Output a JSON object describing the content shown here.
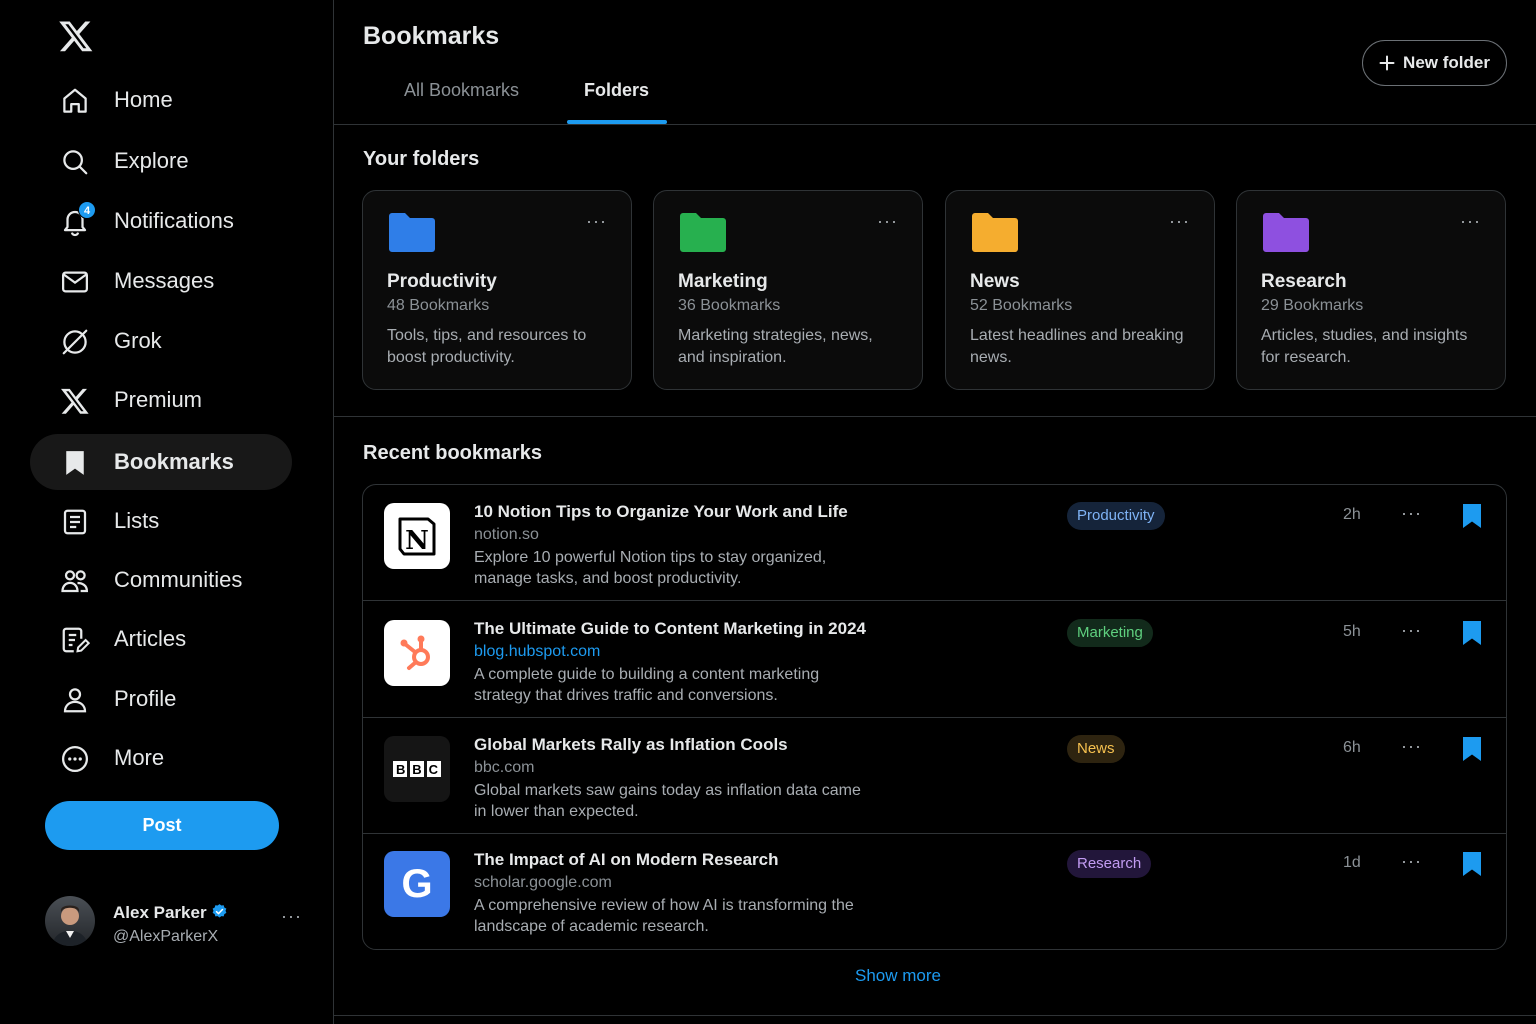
{
  "sidebar": {
    "nav": [
      {
        "label": "Home",
        "icon": "home-icon"
      },
      {
        "label": "Explore",
        "icon": "search-icon"
      },
      {
        "label": "Notifications",
        "icon": "bell-icon",
        "badge": "4"
      },
      {
        "label": "Messages",
        "icon": "mail-icon"
      },
      {
        "label": "Grok",
        "icon": "grok-icon"
      },
      {
        "label": "Premium",
        "icon": "x-logo-icon"
      },
      {
        "label": "Bookmarks",
        "icon": "bookmark-icon",
        "active": true
      },
      {
        "label": "Lists",
        "icon": "list-icon"
      },
      {
        "label": "Communities",
        "icon": "people-icon"
      },
      {
        "label": "Articles",
        "icon": "article-icon"
      },
      {
        "label": "Profile",
        "icon": "person-icon"
      },
      {
        "label": "More",
        "icon": "more-circle-icon"
      }
    ],
    "post_label": "Post",
    "user": {
      "name": "Alex Parker",
      "handle": "@AlexParkerX",
      "more": "···"
    }
  },
  "header": {
    "title": "Bookmarks",
    "new_folder_label": "New folder",
    "tabs": [
      {
        "label": "All Bookmarks",
        "active": false
      },
      {
        "label": "Folders",
        "active": true
      }
    ]
  },
  "folders_section": {
    "title": "Your folders",
    "items": [
      {
        "name": "Productivity",
        "count": "48 Bookmarks",
        "desc": "Tools, tips, and resources to boost productivity.",
        "color": "#2f7ee8",
        "more": "···"
      },
      {
        "name": "Marketing",
        "count": "36 Bookmarks",
        "desc": "Marketing strategies, news, and inspiration.",
        "color": "#27b04f",
        "more": "···"
      },
      {
        "name": "News",
        "count": "52 Bookmarks",
        "desc": "Latest headlines and breaking news.",
        "color": "#f5ad2f",
        "more": "···"
      },
      {
        "name": "Research",
        "count": "29 Bookmarks",
        "desc": "Articles, studies, and insights for research.",
        "color": "#8e50e0",
        "more": "···"
      }
    ]
  },
  "recent_section": {
    "title": "Recent bookmarks",
    "items": [
      {
        "title": "10 Notion Tips to Organize Your Work and Life",
        "domain": "notion.so",
        "desc": "Explore 10 powerful Notion tips to stay organized, manage tasks, and boost productivity.",
        "tag": "Productivity",
        "time": "2h",
        "more": "···",
        "thumb_text": "N"
      },
      {
        "title": "The Ultimate Guide to Content Marketing in 2024",
        "domain": "blog.hubspot.com",
        "desc": "A complete guide to building a content marketing strategy that drives traffic and conversions.",
        "tag": "Marketing",
        "time": "5h",
        "more": "···",
        "thumb_text": ""
      },
      {
        "title": "Global Markets Rally as Inflation Cools",
        "domain": "bbc.com",
        "desc": "Global markets saw gains today as inflation data came in lower than expected.",
        "tag": "News",
        "time": "6h",
        "more": "···",
        "thumb_text": "BBC"
      },
      {
        "title": "The Impact of AI on Modern Research",
        "domain": "scholar.google.com",
        "desc": "A comprehensive review of how AI is transforming the landscape of academic research.",
        "tag": "Research",
        "time": "1d",
        "more": "···",
        "thumb_text": "G"
      }
    ],
    "show_more": "Show more"
  },
  "colors": {
    "accent": "#1d9bf0",
    "background": "#000000",
    "border": "#2f3336"
  }
}
